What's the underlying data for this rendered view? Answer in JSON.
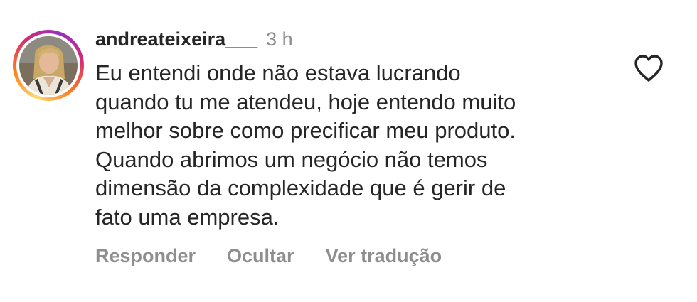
{
  "comment": {
    "username": "andreateixeira___",
    "time": "3 h",
    "lines": [
      "Eu entendi onde não estava lucrando",
      "quando tu me atendeu, hoje entendo muito",
      "melhor sobre como precificar meu produto.",
      "Quando abrimos um negócio não temos",
      "dimensão da complexidade que é gerir de",
      "fato uma empresa."
    ]
  },
  "actions": {
    "reply": "Responder",
    "hide": "Ocultar",
    "translate": "Ver tradução"
  },
  "icons": {
    "like": "heart-outline-icon",
    "avatar": "user-photo"
  },
  "colors": {
    "text": "#262626",
    "secondary": "#8e8e8e",
    "story_ring": [
      "#feda75",
      "#fa7e1e",
      "#d62976",
      "#962fbf"
    ]
  }
}
